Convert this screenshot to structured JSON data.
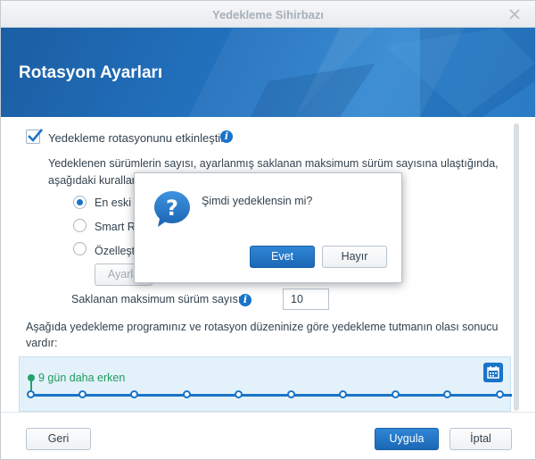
{
  "window": {
    "title": "Yedekleme Sihirbazı"
  },
  "banner": {
    "heading": "Rotasyon Ayarları"
  },
  "rotation": {
    "enable_label": "Yedekleme rotasyonunu etkinleştir",
    "enabled": true,
    "description": "Yedeklenen sürümlerin sayısı, ayarlanmış saklanan maksimum sürüm sayısına ulaştığında, aşağıdaki kuralları",
    "options": [
      {
        "label": "En eski s",
        "selected": true
      },
      {
        "label": "Smart Re",
        "selected": false
      },
      {
        "label": "Özelleşt",
        "selected": false
      }
    ],
    "settings_button": "Ayarla",
    "max_versions_label": "Saklanan maksimum sürüm sayısı",
    "max_versions_value": "10",
    "result_description": "Aşağıda yedekleme programınız ve rotasyon düzeninize göre yedekleme tutmanın olası sonucu vardır:"
  },
  "timeline": {
    "flag_label": "9 gün daha erken",
    "calendar_icon": "calendar-icon"
  },
  "footer": {
    "back": "Geri",
    "apply": "Uygula",
    "cancel": "İptal"
  },
  "dialog": {
    "message": "Şimdi yedeklensin mi?",
    "yes": "Evet",
    "no": "Hayır"
  },
  "colors": {
    "accent": "#1a74c8",
    "banner": "#2373c0",
    "timeline_flag": "#23a36a"
  }
}
